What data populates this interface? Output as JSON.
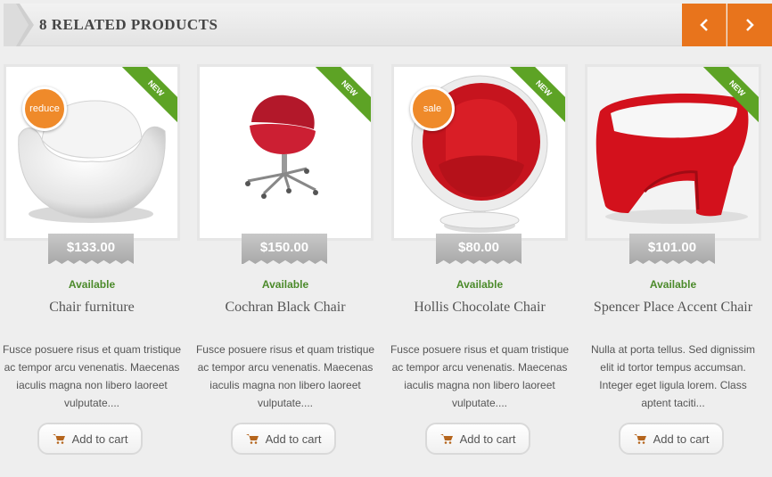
{
  "header": {
    "title": "8 RELATED PRODUCTS",
    "prev_icon": "chevron-left-icon",
    "next_icon": "chevron-right-icon",
    "accent_color": "#e8741c"
  },
  "ribbon_label": "NEW",
  "cart_icon": "cart-icon",
  "products": [
    {
      "badge": "reduce",
      "price": "$133.00",
      "availability": "Available",
      "name": "Chair furniture",
      "description": "Fusce posuere risus et quam tristique ac tempor arcu venenatis. Maecenas iaculis magna non libero laoreet vulputate....",
      "button": "Add to cart"
    },
    {
      "price": "$150.00",
      "availability": "Available",
      "name": "Cochran Black Chair",
      "description": "Fusce posuere risus et quam tristique ac tempor arcu venenatis. Maecenas iaculis magna non libero laoreet vulputate....",
      "button": "Add to cart"
    },
    {
      "badge": "sale",
      "price": "$80.00",
      "availability": "Available",
      "name": "Hollis Chocolate Chair",
      "description": "Fusce posuere risus et quam tristique ac tempor arcu venenatis. Maecenas iaculis magna non libero laoreet vulputate....",
      "button": "Add to cart"
    },
    {
      "price": "$101.00",
      "availability": "Available",
      "name": "Spencer Place Accent Chair",
      "description": "Nulla at porta tellus. Sed dignissim elit id tortor tempus accumsan. Integer eget ligula lorem. Class aptent taciti...",
      "button": "Add to cart"
    }
  ]
}
